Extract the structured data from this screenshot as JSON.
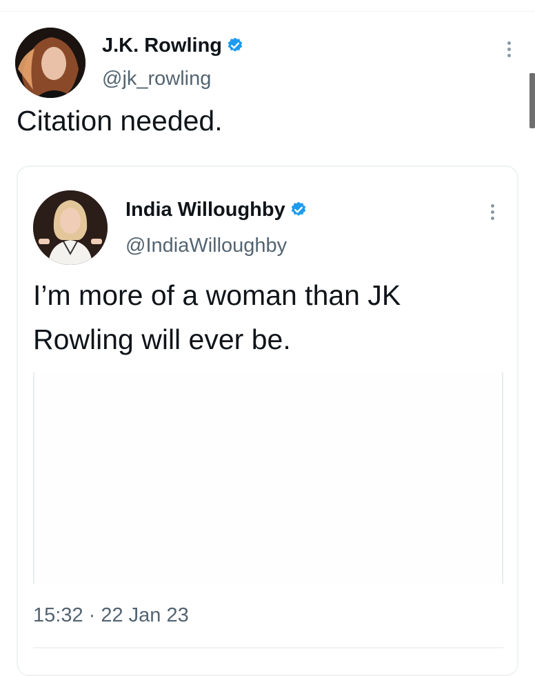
{
  "tweet": {
    "author": {
      "display_name": "J.K. Rowling",
      "handle": "@jk_rowling",
      "verified": true
    },
    "text": "Citation needed."
  },
  "quoted_tweet": {
    "author": {
      "display_name": "India Willoughby",
      "handle": "@IndiaWilloughby",
      "verified": true
    },
    "text": "I’m more of a woman than JK Rowling will ever be.",
    "timestamp": "15:32 · 22 Jan 23"
  },
  "colors": {
    "verified_badge": "#1d9bf0",
    "primary_text": "#0f1419",
    "secondary_text": "#536471",
    "divider": "#eff3f4"
  }
}
